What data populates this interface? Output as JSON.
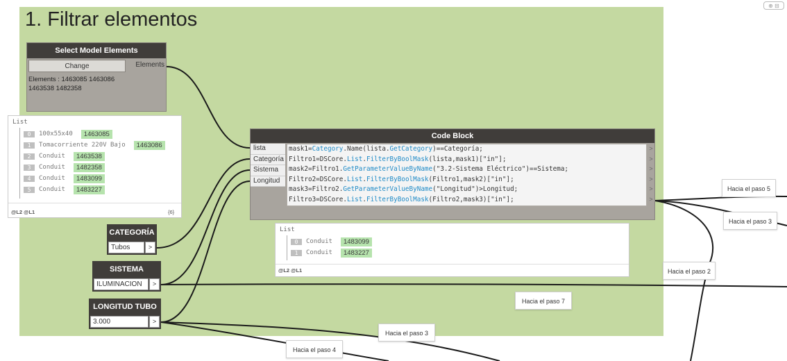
{
  "group": {
    "title": "1. Filtrar elementos",
    "color": "#c4d9a1"
  },
  "select_node": {
    "title": "Select Model Elements",
    "change_button": "Change",
    "output_port": "Elements",
    "info": "Elements : 1463085 1463086 1463538 1482358"
  },
  "watch1": {
    "list_title": "List",
    "rows": [
      {
        "index": "0",
        "name": "100x55x40",
        "value": "1463085"
      },
      {
        "index": "1",
        "name": "Tomacorriente 220V Bajo",
        "value": "1463086"
      },
      {
        "index": "2",
        "name": "Conduit",
        "value": "1463538"
      },
      {
        "index": "3",
        "name": "Conduit",
        "value": "1482358"
      },
      {
        "index": "4",
        "name": "Conduit",
        "value": "1483099"
      },
      {
        "index": "5",
        "name": "Conduit",
        "value": "1483227"
      }
    ],
    "footer_left": "@L2 @L1",
    "footer_right": "{6}"
  },
  "code_block": {
    "title": "Code Block",
    "inputs": [
      "lista",
      "Categoría",
      "Sistema",
      "Longitud"
    ],
    "lines": [
      "mask1=Category.Name(lista.GetCategory)==Categoría;",
      "Filtro1=DSCore.List.FilterByBoolMask(lista,mask1)[\"in\"];",
      "mask2=Filtro1.GetParameterValueByName(\"3.2-Sistema Eléctrico\")==Sistema;",
      "Filtro2=DSCore.List.FilterByBoolMask(Filtro1,mask2)[\"in\"];",
      "mask3=Filtro2.GetParameterValueByName(\"Longitud\")>Longitud;",
      "Filtro3=DSCore.List.FilterByBoolMask(Filtro2,mask3)[\"in\"];"
    ],
    "output_arrow": ">"
  },
  "watch2": {
    "list_title": "List",
    "rows": [
      {
        "index": "0",
        "name": "Conduit",
        "value": "1483099"
      },
      {
        "index": "1",
        "name": "Conduit",
        "value": "1483227"
      }
    ],
    "footer_left": "@L2 @L1"
  },
  "inputs": {
    "categoria": {
      "title": "CATEGORÍA",
      "value": "Tubos",
      "arrow": ">"
    },
    "sistema": {
      "title": "SISTEMA",
      "value": "ILUMINACION",
      "arrow": ">"
    },
    "longitud": {
      "title": "LONGITUD TUBO",
      "value": "3.000",
      "arrow": ">"
    }
  },
  "notes": {
    "paso5": "Hacia el paso 5",
    "paso3a": "Hacia el paso 3",
    "paso2": "Hacia el paso 2",
    "paso7": "Hacia el paso 7",
    "paso3b": "Hacia el paso 3",
    "paso4": "Hacia el paso 4"
  }
}
